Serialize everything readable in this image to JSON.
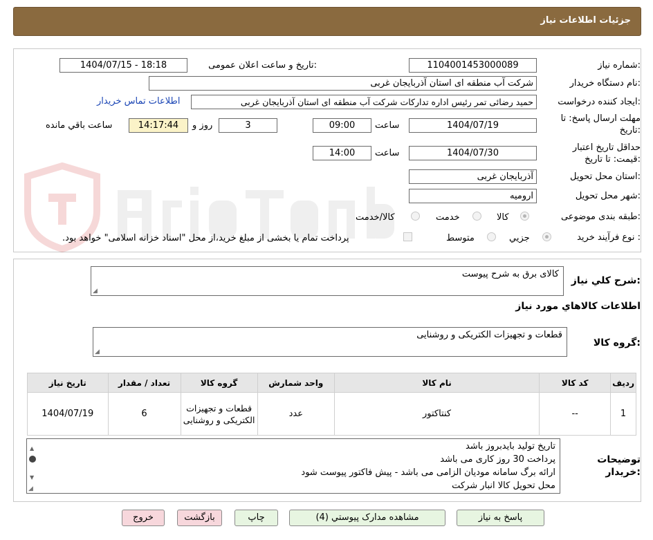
{
  "header": {
    "title": "جزئیات اطلاعات نیاز"
  },
  "form": {
    "need_number_label": "شماره نیاز:",
    "need_number": "1104001453000089",
    "announce_label": "تاریخ و ساعت اعلان عمومی:",
    "announce_value": "1404/07/15 - 18:18",
    "buyer_org_label": "نام دستگاه خریدار:",
    "buyer_org": "شرکت آب منطقه ای استان آذربایجان غربی",
    "requester_label": "ایجاد کننده درخواست:",
    "requester": "حمید رضائی تمر رئیس اداره تدارکات شرکت آب منطقه ای استان آذربایجان غربی",
    "contact_link": "اطلاعات تماس خریدار",
    "deadline_label_1": "مهلت ارسال پاسخ: تا",
    "deadline_label_2": "تاریخ:",
    "deadline_date": "1404/07/19",
    "time_label": "ساعت",
    "deadline_time": "09:00",
    "days_value": "3",
    "days_label": "روز و",
    "remaining_value": "14:17:44",
    "remaining_label": "ساعت باقي مانده",
    "validity_label_1": "حداقل تاریخ اعتبار",
    "validity_label_2": "قیمت: تا تاریخ:",
    "validity_date": "1404/07/30",
    "validity_time_label": "ساعت",
    "validity_time": "14:00",
    "province_label": "استان محل تحویل:",
    "province": "آذربایجان غربی",
    "city_label": "شهر محل تحویل:",
    "city": "ارومیه",
    "category_label": "طبقه بندی موضوعی:",
    "category_options": [
      "کالا",
      "خدمت",
      "کالا/خدمت"
    ],
    "process_label": "نوع فرآیند خرید :",
    "process_options": [
      "جزیي",
      "متوسط"
    ],
    "payment_note": "پرداخت تمام یا بخشی از مبلغ خرید،از محل \"اسناد خزانه اسلامی\" خواهد بود."
  },
  "summary": {
    "general_desc_label": "شرح کلي نیاز:",
    "general_desc": "کالای برق به شرح پیوست",
    "goods_info_title": "اطلاعات کالاهاي مورد نیاز",
    "goods_group_label": "گروه کالا:",
    "goods_group": "قطعات و تجهیزات الکتریکی و روشنایی"
  },
  "table": {
    "headers": [
      "ردیف",
      "کد کالا",
      "نام کالا",
      "واحد شمارش",
      "گروه کالا",
      "تعداد / مقدار",
      "تاریخ نیاز"
    ],
    "rows": [
      [
        "1",
        "--",
        "کنتاکتور",
        "عدد",
        "قطعات و تجهیزات الکتریکی و روشنایی",
        "6",
        "1404/07/19"
      ]
    ]
  },
  "buyer_notes": {
    "label_1": "توضیحات",
    "label_2": "خریدار:",
    "lines": [
      "تاریخ تولید بایدبروز باشد",
      "پرداخت 30 روز کاری می باشد",
      "ارائه برگ سامانه مودیان الزامی  می باشد - پیش فاکتور پیوست شود",
      "محل تحویل کالا انبار شرکت"
    ]
  },
  "buttons": {
    "reply": "پاسخ به نیاز",
    "attachments": "مشاهده مدارک پیوستي (4)",
    "print": "چاپ",
    "back": "بازگشت",
    "exit": "خروج"
  },
  "colors": {
    "header_bg": "#8a6a3f",
    "button_green": "#e7f5e1",
    "button_pink": "#f7d7dc",
    "remaining_bg": "#fbf3c8",
    "link": "#1a45b5"
  }
}
